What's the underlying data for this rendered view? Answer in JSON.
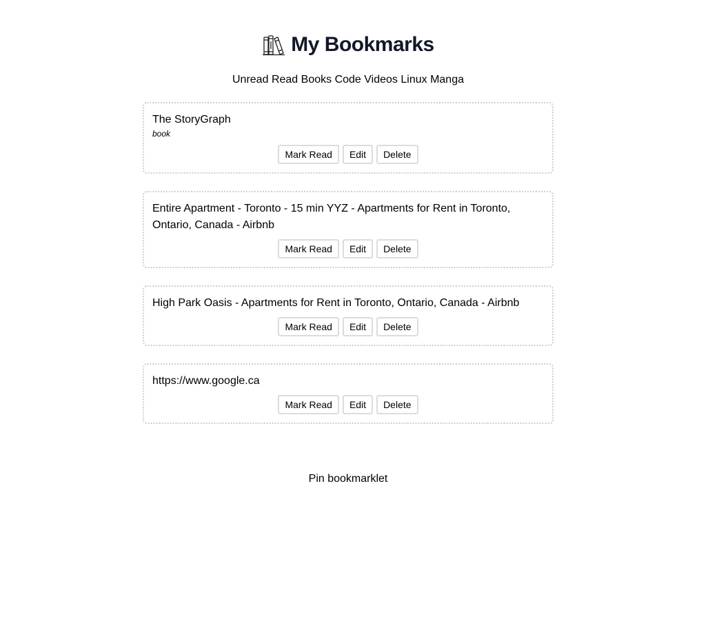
{
  "header": {
    "logo_icon": "books-icon",
    "title": "My Bookmarks"
  },
  "nav": {
    "items": [
      "Unread",
      "Read",
      "Books",
      "Code",
      "Videos",
      "Linux",
      "Manga"
    ]
  },
  "bookmarks": [
    {
      "title": "The StoryGraph",
      "tag": "book",
      "actions": {
        "mark_read": "Mark Read",
        "edit": "Edit",
        "delete": "Delete"
      }
    },
    {
      "title": "Entire Apartment - Toronto - 15 min YYZ - Apartments for Rent in Toronto, Ontario, Canada - Airbnb",
      "actions": {
        "mark_read": "Mark Read",
        "edit": "Edit",
        "delete": "Delete"
      }
    },
    {
      "title": "High Park Oasis - Apartments for Rent in Toronto, Ontario, Canada - Airbnb",
      "actions": {
        "mark_read": "Mark Read",
        "edit": "Edit",
        "delete": "Delete"
      }
    },
    {
      "title": "https://www.google.ca",
      "actions": {
        "mark_read": "Mark Read",
        "edit": "Edit",
        "delete": "Delete"
      }
    }
  ],
  "footer": {
    "bookmarklet_label": "Pin bookmarklet"
  }
}
